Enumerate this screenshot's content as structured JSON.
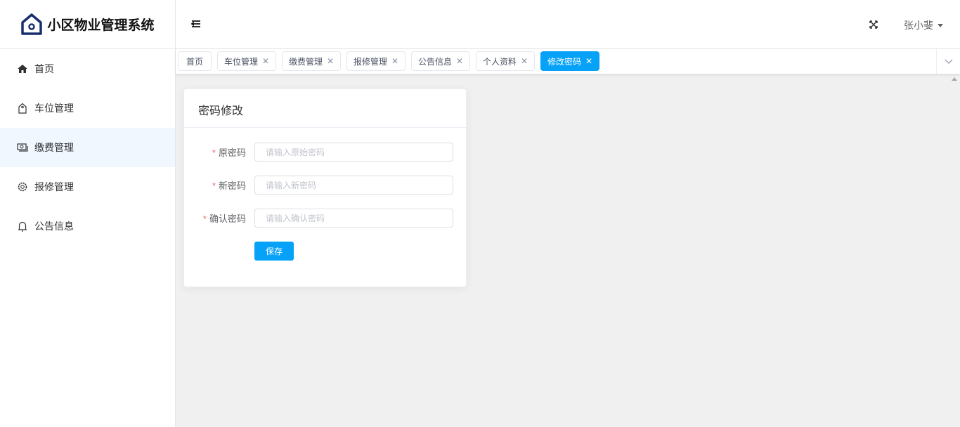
{
  "app": {
    "title": "小区物业管理系统"
  },
  "sidebar": {
    "items": [
      {
        "label": "首页",
        "icon": "home-icon"
      },
      {
        "label": "车位管理",
        "icon": "tag-icon"
      },
      {
        "label": "缴费管理",
        "icon": "money-icon"
      },
      {
        "label": "报修管理",
        "icon": "gear-icon"
      },
      {
        "label": "公告信息",
        "icon": "bell-icon"
      }
    ],
    "active": "缴费管理"
  },
  "header": {
    "user": "张小斐"
  },
  "tabs": [
    {
      "label": "首页"
    },
    {
      "label": "车位管理"
    },
    {
      "label": "缴费管理"
    },
    {
      "label": "报修管理"
    },
    {
      "label": "公告信息"
    },
    {
      "label": "个人资料"
    },
    {
      "label": "修改密码",
      "active": true
    }
  ],
  "form": {
    "title": "密码修改",
    "fields": [
      {
        "label": "原密码",
        "placeholder": "请输入原始密码",
        "required": "*"
      },
      {
        "label": "新密码",
        "placeholder": "请输入新密码",
        "required": "*"
      },
      {
        "label": "确认密码",
        "placeholder": "请输入确认密码",
        "required": "*"
      }
    ],
    "save": "保存"
  },
  "colors": {
    "accent": "#06a2f8",
    "logo": "#1a2f6e"
  }
}
